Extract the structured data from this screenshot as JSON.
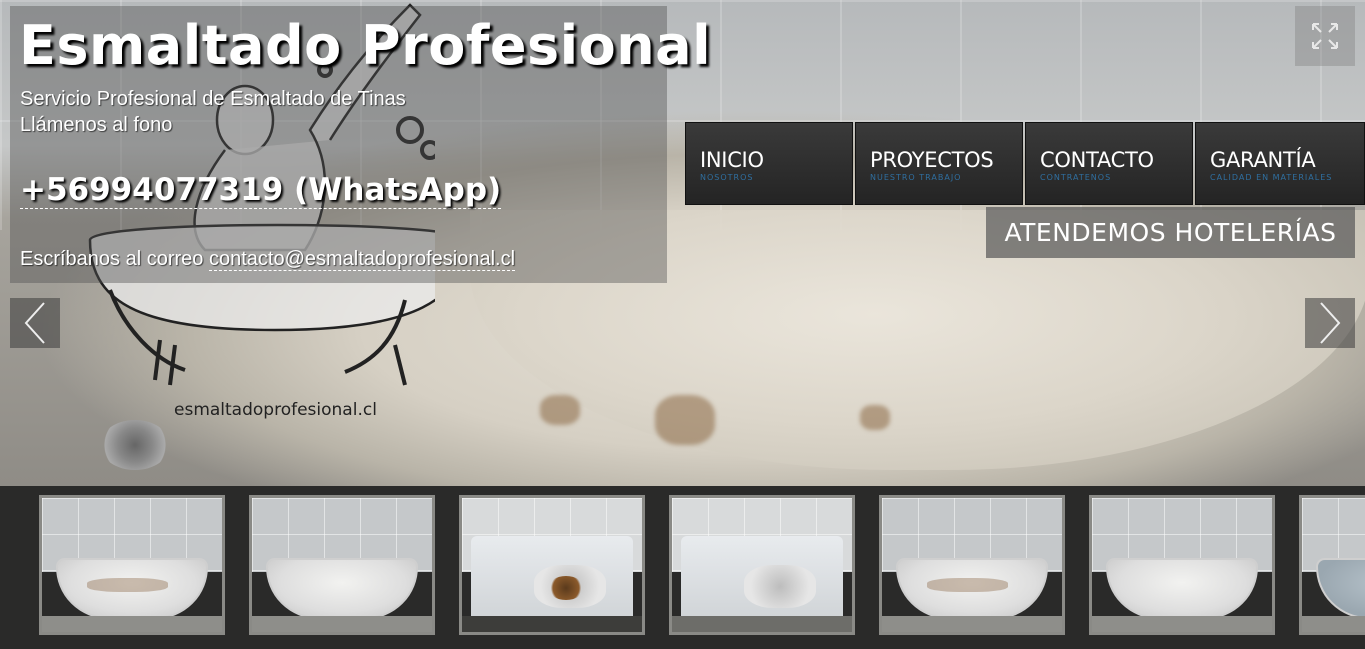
{
  "header": {
    "title": "Esmaltado Profesional",
    "tagline_line1": "Servicio Profesional de Esmaltado de Tinas",
    "tagline_line2": "Llámenos al fono",
    "phone": "+56994077319 (WhatsApp)",
    "email_prefix": "Escríbanos al correo ",
    "email": "contacto@esmaltadoprofesional.cl"
  },
  "logo": {
    "caption": "esmaltadoprofesional.cl"
  },
  "nav": {
    "items": [
      {
        "label": "INICIO",
        "sub": "NOSOTROS"
      },
      {
        "label": "PROYECTOS",
        "sub": "NUESTRO TRABAJO"
      },
      {
        "label": "CONTACTO",
        "sub": "CONTRATENOS"
      },
      {
        "label": "GARANTÍA",
        "sub": "CALIDAD EN MATERIALES"
      }
    ]
  },
  "banner": {
    "text": "ATENDEMOS HOTELERÍAS"
  },
  "controls": {
    "fullscreen_icon": "expand-icon",
    "prev_icon": "chevron-left-icon",
    "next_icon": "chevron-right-icon"
  },
  "thumbnails": [
    {
      "kind": "tub-dirty"
    },
    {
      "kind": "tub-clean"
    },
    {
      "kind": "sink-dirty"
    },
    {
      "kind": "sink-clean"
    },
    {
      "kind": "tub-dirty"
    },
    {
      "kind": "tub-clean"
    },
    {
      "kind": "tub-partial"
    }
  ],
  "colors": {
    "nav_sub": "#2f6fa0",
    "nav_bg": "#2c2c2c",
    "thumb_border": "#8a8a86"
  }
}
